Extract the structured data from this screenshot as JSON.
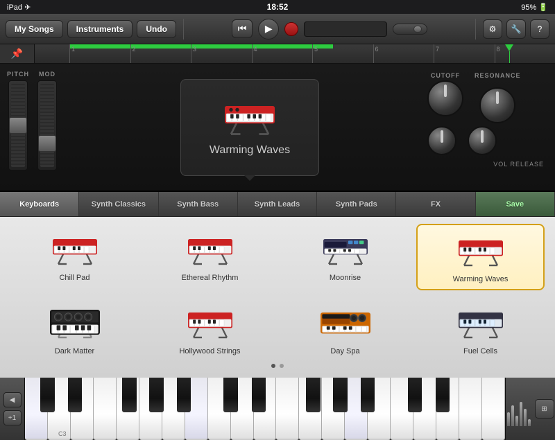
{
  "statusBar": {
    "left": "iPad ✈",
    "time": "18:52",
    "right": "95% 🔋"
  },
  "toolbar": {
    "mySongs": "My Songs",
    "instruments": "Instruments",
    "undo": "Undo"
  },
  "timeline": {
    "marks": [
      "1",
      "2",
      "3",
      "4",
      "5",
      "6",
      "7",
      "8"
    ]
  },
  "synth": {
    "pitchLabel": "PITCH",
    "modLabel": "MOD",
    "cutoffLabel": "CUTOFF",
    "resonanceLabel": "RESONANCE",
    "volReleaseLabel": "VOL RELEASE",
    "currentInstrument": "Warming Waves"
  },
  "browserTabs": [
    {
      "label": "Keyboards",
      "active": true
    },
    {
      "label": "Synth Classics",
      "active": false
    },
    {
      "label": "Synth Bass",
      "active": false
    },
    {
      "label": "Synth Leads",
      "active": false
    },
    {
      "label": "Synth Pads",
      "active": false
    },
    {
      "label": "FX",
      "active": false
    },
    {
      "label": "Save",
      "active": false
    }
  ],
  "instruments": [
    {
      "name": "Chill Pad",
      "selected": false,
      "row": 0,
      "col": 0,
      "color": "#cc2222"
    },
    {
      "name": "Ethereal Rhythm",
      "selected": false,
      "row": 0,
      "col": 1,
      "color": "#cc2222"
    },
    {
      "name": "Moonrise",
      "selected": false,
      "row": 0,
      "col": 2,
      "color": "#4488cc"
    },
    {
      "name": "Warming Waves",
      "selected": true,
      "row": 0,
      "col": 3,
      "color": "#cc2222"
    },
    {
      "name": "Dark Matter",
      "selected": false,
      "row": 1,
      "col": 0,
      "color": "#222222"
    },
    {
      "name": "Hollywood Strings",
      "selected": false,
      "row": 1,
      "col": 1,
      "color": "#cc2222"
    },
    {
      "name": "Day Spa",
      "selected": false,
      "row": 1,
      "col": 2,
      "color": "#cc6600"
    },
    {
      "name": "Fuel Cells",
      "selected": false,
      "row": 1,
      "col": 3,
      "color": "#333344"
    }
  ],
  "piano": {
    "c3Label": "C3",
    "octaveDown": "◀",
    "octavePlus": "+1"
  }
}
